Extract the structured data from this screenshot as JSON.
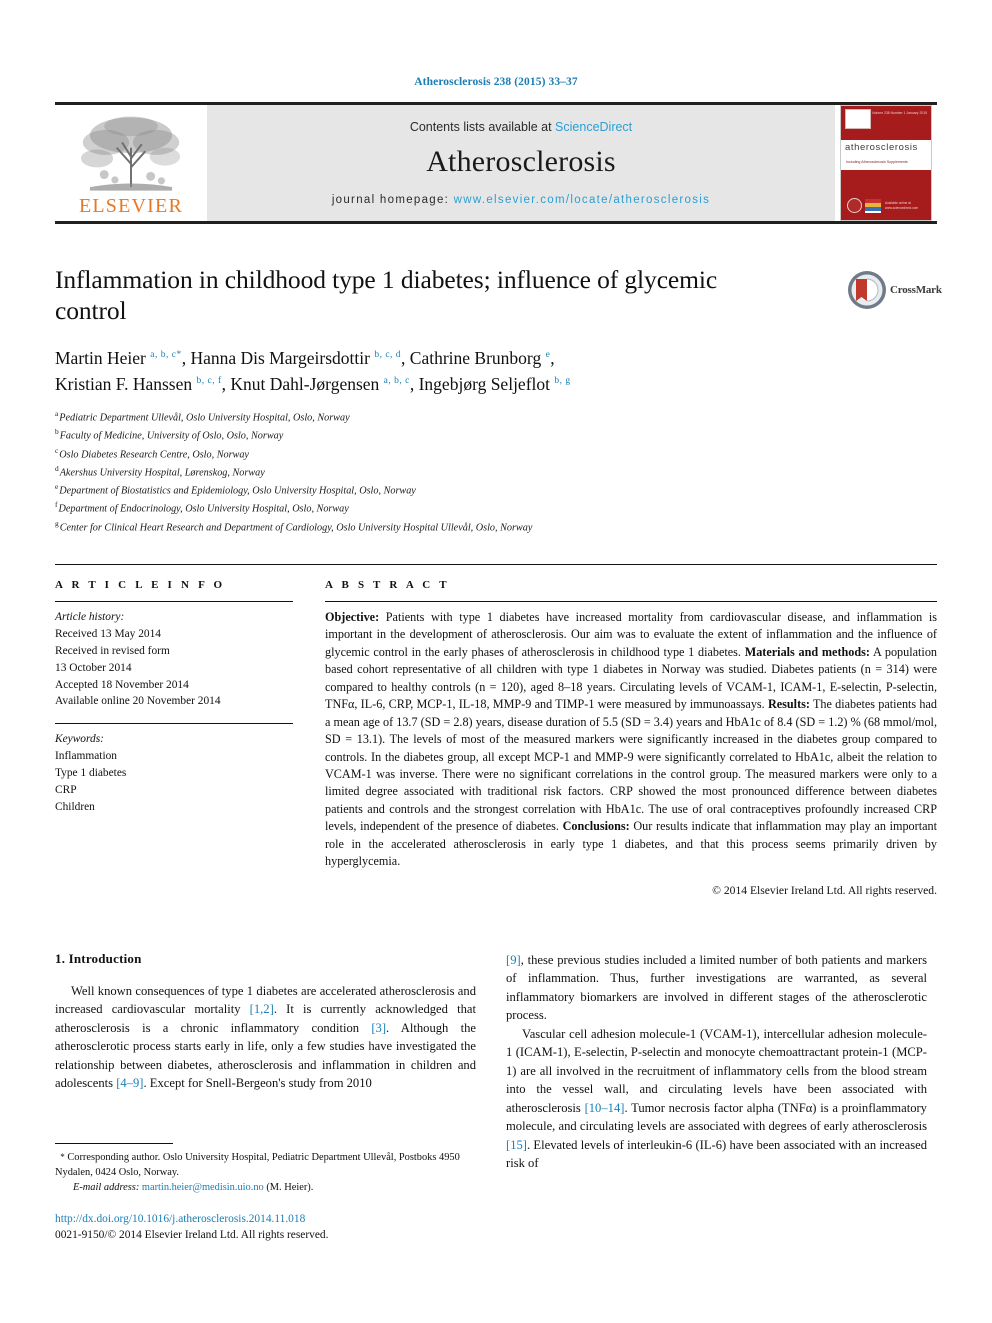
{
  "running_head": "Atherosclerosis 238 (2015) 33–37",
  "masthead": {
    "publisher_name": "ELSEVIER",
    "contents_prefix": "Contents lists available at ",
    "contents_link": "ScienceDirect",
    "journal_name": "Atherosclerosis",
    "homepage_label": "journal homepage: ",
    "homepage_url": "www.elsevier.com/locate/atherosclerosis",
    "cover": {
      "title": "atherosclerosis",
      "subtitle": "Including Atherosclerosis Supplements",
      "top_note": "Volume 238  Number 1  January 2015",
      "footer_note": "Available online at www.sciencedirect.com"
    }
  },
  "article": {
    "title": "Inflammation in childhood type 1 diabetes; influence of glycemic control",
    "crossmark_label": "CrossMark",
    "authors": [
      {
        "name": "Martin Heier",
        "marks": "a, b, c",
        "corresponding": true
      },
      {
        "name": "Hanna Dis Margeirsdottir",
        "marks": "b, c, d",
        "corresponding": false
      },
      {
        "name": "Cathrine Brunborg",
        "marks": "e",
        "corresponding": false
      },
      {
        "name": "Kristian F. Hanssen",
        "marks": "b, c, f",
        "corresponding": false
      },
      {
        "name": "Knut Dahl-Jørgensen",
        "marks": "a, b, c",
        "corresponding": false
      },
      {
        "name": "Ingebjørg Seljeflot",
        "marks": "b, g",
        "corresponding": false
      }
    ],
    "affiliations": [
      {
        "mark": "a",
        "text": "Pediatric Department Ullevål, Oslo University Hospital, Oslo, Norway"
      },
      {
        "mark": "b",
        "text": "Faculty of Medicine, University of Oslo, Oslo, Norway"
      },
      {
        "mark": "c",
        "text": "Oslo Diabetes Research Centre, Oslo, Norway"
      },
      {
        "mark": "d",
        "text": "Akershus University Hospital, Lørenskog, Norway"
      },
      {
        "mark": "e",
        "text": "Department of Biostatistics and Epidemiology, Oslo University Hospital, Oslo, Norway"
      },
      {
        "mark": "f",
        "text": "Department of Endocrinology, Oslo University Hospital, Oslo, Norway"
      },
      {
        "mark": "g",
        "text": "Center for Clinical Heart Research and Department of Cardiology, Oslo University Hospital Ullevål, Oslo, Norway"
      }
    ]
  },
  "article_info": {
    "heading": "A R T I C L E   I N F O",
    "history_title": "Article history:",
    "history": [
      "Received 13 May 2014",
      "Received in revised form",
      "13 October 2014",
      "Accepted 18 November 2014",
      "Available online 20 November 2014"
    ],
    "keywords_title": "Keywords:",
    "keywords": [
      "Inflammation",
      "Type 1 diabetes",
      "CRP",
      "Children"
    ]
  },
  "abstract": {
    "heading": "A B S T R A C T",
    "sections": [
      {
        "label": "Objective:",
        "text": " Patients with type 1 diabetes have increased mortality from cardiovascular disease, and inflammation is important in the development of atherosclerosis. Our aim was to evaluate the extent of inflammation and the influence of glycemic control in the early phases of atherosclerosis in childhood type 1 diabetes. "
      },
      {
        "label": "Materials and methods:",
        "text": " A population based cohort representative of all children with type 1 diabetes in Norway was studied. Diabetes patients (n = 314) were compared to healthy controls (n = 120), aged 8–18 years. Circulating levels of VCAM-1, ICAM-1, E-selectin, P-selectin, TNFα, IL-6, CRP, MCP-1, IL-18, MMP-9 and TIMP-1 were measured by immunoassays. "
      },
      {
        "label": "Results:",
        "text": " The diabetes patients had a mean age of 13.7 (SD = 2.8) years, disease duration of 5.5 (SD = 3.4) years and HbA1c of 8.4 (SD = 1.2) % (68 mmol/mol, SD = 13.1). The levels of most of the measured markers were significantly increased in the diabetes group compared to controls. In the diabetes group, all except MCP-1 and MMP-9 were significantly correlated to HbA1c, albeit the relation to VCAM-1 was inverse. There were no significant correlations in the control group. The measured markers were only to a limited degree associated with traditional risk factors. CRP showed the most pronounced difference between diabetes patients and controls and the strongest correlation with HbA1c. The use of oral contraceptives profoundly increased CRP levels, independent of the presence of diabetes. "
      },
      {
        "label": "Conclusions:",
        "text": " Our results indicate that inflammation may play an important role in the accelerated atherosclerosis in early type 1 diabetes, and that this process seems primarily driven by hyperglycemia."
      }
    ],
    "copyright": "© 2014 Elsevier Ireland Ltd. All rights reserved."
  },
  "introduction": {
    "heading": "1. Introduction",
    "left_paragraphs": [
      "Well known consequences of type 1 diabetes are accelerated atherosclerosis and increased cardiovascular mortality [1,2]. It is currently acknowledged that atherosclerosis is a chronic inflammatory condition [3]. Although the atherosclerotic process starts early in life, only a few studies have investigated the relationship between diabetes, atherosclerosis and inflammation in children and adolescents [4–9]. Except for Snell-Bergeon's study from 2010"
    ],
    "right_paragraphs": [
      "[9], these previous studies included a limited number of both patients and markers of inflammation. Thus, further investigations are warranted, as several inflammatory biomarkers are involved in different stages of the atherosclerotic process.",
      "Vascular cell adhesion molecule-1 (VCAM-1), intercellular adhesion molecule-1 (ICAM-1), E-selectin, P-selectin and monocyte chemoattractant protein-1 (MCP-1) are all involved in the recruitment of inflammatory cells from the blood stream into the vessel wall, and circulating levels have been associated with atherosclerosis [10–14]. Tumor necrosis factor alpha (TNFα) is a proinflammatory molecule, and circulating levels are associated with degrees of early atherosclerosis [15]. Elevated levels of interleukin-6 (IL-6) have been associated with an increased risk of"
    ],
    "citations_left": [
      "[1,2]",
      "[3]",
      "[4–9]"
    ],
    "citations_right": [
      "[9]",
      "[10–14]",
      "[15]"
    ]
  },
  "footnote": {
    "corresponding_marker": "*",
    "corresponding_text": "Corresponding author. Oslo University Hospital, Pediatric Department Ullevål, Postboks 4950 Nydalen, 0424 Oslo, Norway.",
    "email_label": "E-mail address:",
    "email": "martin.heier@medisin.uio.no",
    "email_owner": "(M. Heier)."
  },
  "document_footer": {
    "doi": "http://dx.doi.org/10.1016/j.atherosclerosis.2014.11.018",
    "issn_line": "0021-9150/© 2014 Elsevier Ireland Ltd. All rights reserved."
  },
  "colors": {
    "link_blue": "#1a7eb5",
    "sciencedirect_blue": "#2b9fd4",
    "elsevier_orange": "#e87722",
    "cover_red": "#a61c1c",
    "masthead_grey": "#e6e6e6"
  }
}
